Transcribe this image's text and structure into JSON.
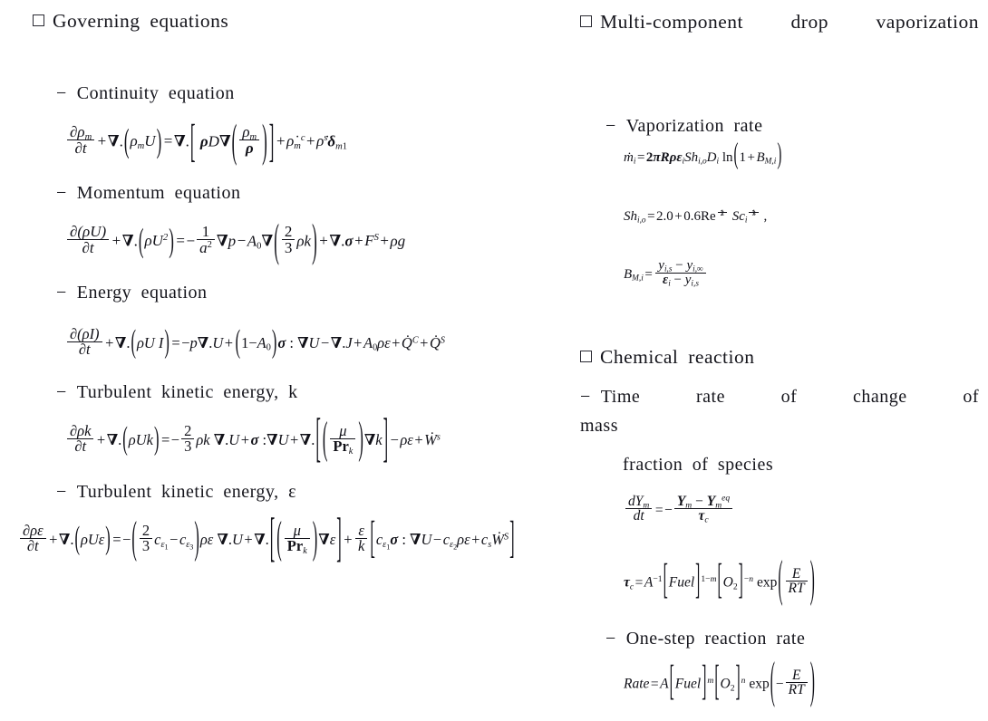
{
  "slide": {
    "left_column": {
      "heading": {
        "bullet": "square-bullet",
        "text": "Governing equations"
      },
      "items": [
        {
          "label": "Continuity equation",
          "equation_text": "∂ρm/∂t + ∇.(ρmU) = ∇.[ ρD∇(ρm/ρ) ] + ρ̇mᶜ + ρ̇ˢ δm1"
        },
        {
          "label": "Momentum equation",
          "equation_text": "∂(ρU)/∂t + ∇.(ρU²) = −(1/a²)∇p − A₀∇(2/3 ρk) + ∇.σ + Fˢ + ρg"
        },
        {
          "label": "Energy equation",
          "equation_text": "∂(ρI)/∂t + ∇.(ρU I) = −p∇.U + (1−A₀)σ:∇U − ∇.J + A₀ρε + Q̇ᶜ + Q̇ˢ"
        },
        {
          "label": "Turbulent kinetic energy, k",
          "equation_text": "∂ρk/∂t + ∇.(ρUk) = −(2/3)ρk∇.U + σ:∇U + ∇.[ (μ/Prₖ)∇k ] − ρε + Ẇˢ"
        },
        {
          "label": "Turbulent kinetic energy, ε",
          "equation_text": "∂ρε/∂t + ∇.(ρUε) = −(2/3 cε1 − cε3)ρε∇.U + ∇.[ (μ/Prₖ)∇ε ] + (ε/k)[ cε1σ:∇U − cε2ρε + cₛ Ẇˢ ]"
        }
      ]
    },
    "right_column": {
      "heading_1": {
        "bullet": "square-bullet",
        "text": "Multi-component drop vaporization"
      },
      "item_1": {
        "label": "Vaporization rate",
        "equations": [
          "ṁᵢ = 2πRρεᵢ Shᵢ,ₒ Dᵢ ln(1 + Bₘ,ᵢ)",
          "Shᵢ,ₒ = 2.0 + 0.6 Re^(1/2) Scᵢ^(1/3) ,",
          "Bₘ,ᵢ = (yᵢ,ₛ − yᵢ,∞) / (εᵢ − yᵢ,ₛ)"
        ]
      },
      "heading_2": {
        "bullet": "square-bullet",
        "text": "Chemical reaction"
      },
      "item_2": {
        "label_line1": "Time rate of change of",
        "label_line2": "mass",
        "label_line3": "fraction of species",
        "equations": [
          "dYₘ/dt = − (Yₘ − Yₘ^eq) / τꟳ",
          "τꟳ = A⁻¹ [Fuel]^(1−m) [O₂]^(−n) exp(E/RT)"
        ]
      },
      "item_3": {
        "label": "One-step reaction rate",
        "equations": [
          "Rate = A[Fuel]^m [O₂]^n exp(−E/RT)"
        ]
      }
    }
  }
}
